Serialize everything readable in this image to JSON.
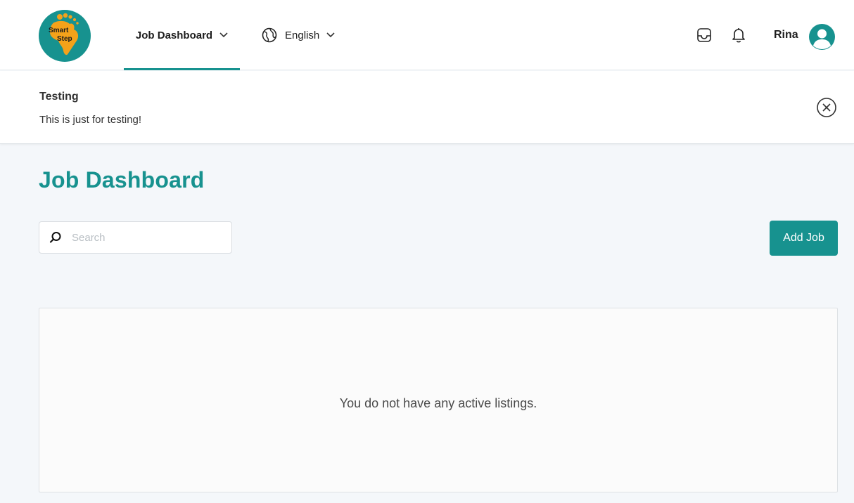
{
  "logo": {
    "text_line1": "Smart",
    "text_line2": "Step",
    "icon": "smart-step-logo"
  },
  "nav": {
    "job_dashboard_label": "Job Dashboard",
    "language_label": "English",
    "language_icon": "globe-icon"
  },
  "header_icons": {
    "inbox": "inbox-icon",
    "bell": "bell-icon"
  },
  "user": {
    "name": "Rina",
    "avatar_icon": "user-avatar-icon"
  },
  "banner": {
    "title": "Testing",
    "message": "This is just for testing!",
    "close_icon": "close-circle-icon"
  },
  "main": {
    "title": "Job Dashboard",
    "search": {
      "placeholder": "Search",
      "value": ""
    },
    "add_button_label": "Add Job",
    "empty_message": "You do not have any active listings."
  },
  "colors": {
    "accent": "#17928f",
    "background": "#f4f7fa",
    "panel": "#fbfbfb"
  }
}
